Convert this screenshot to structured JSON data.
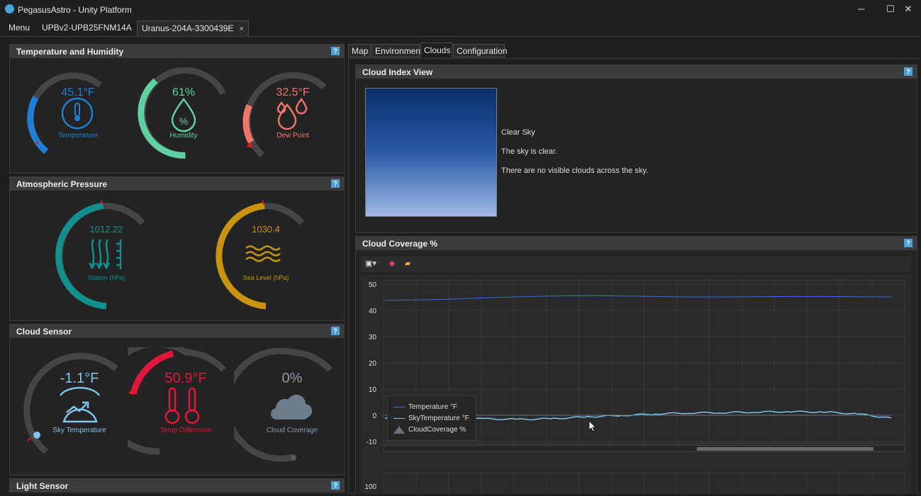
{
  "window": {
    "title": "PegasusAstro - Unity Platform",
    "minimize": "─",
    "maximize": "☐",
    "close": "✕"
  },
  "tabs": {
    "menu": "Menu",
    "device1": "UPBv2-UPB25FNM14A",
    "device2": "Uranus-204A-3300439E",
    "close": "×"
  },
  "help_label": "?",
  "panels": {
    "temp_humidity": {
      "title": "Temperature and Humidity",
      "temperature": {
        "value": "45.1°F",
        "label": "Temperature",
        "color": "#1f7fd6"
      },
      "humidity": {
        "value": "61%",
        "label": "Humidity",
        "color": "#5fd0a0"
      },
      "dew_point": {
        "value": "32.5°F",
        "label": "Dew Point",
        "color": "#f0746a"
      }
    },
    "pressure": {
      "title": "Atmospheric Pressure",
      "station": {
        "value": "1012.22",
        "label": "Station (hPa)",
        "color": "#12908f"
      },
      "sea_level": {
        "value": "1030.4",
        "label": "Sea Level (hPa)",
        "color": "#c9930d"
      }
    },
    "cloud_sensor": {
      "title": "Cloud Sensor",
      "sky_temperature": {
        "value": "-1.1°F",
        "label": "Sky Temperature",
        "color": "#7fc4ec"
      },
      "temp_difference": {
        "value": "50.9°F",
        "label": "Temp Difference",
        "color": "#e0173a"
      },
      "cloud_coverage": {
        "value": "0%",
        "label": "Cloud Coverage",
        "color": "#8a9aa8"
      }
    },
    "light_sensor": {
      "title": "Light Sensor"
    }
  },
  "right_tabs": [
    "Map",
    "Environment",
    "Clouds",
    "Configuration"
  ],
  "cloud_index": {
    "title": "Cloud Index View",
    "status": "Clear Sky",
    "line1": "The sky is clear.",
    "line2": "There are no visible clouds across the sky."
  },
  "cloud_coverage_chart": {
    "title": "Cloud Coverage %",
    "toolbar_icons": [
      "save-icon",
      "eraser-icon",
      "folder-open-icon"
    ],
    "legend": [
      "Temperature °F",
      "SkyTemperature °F",
      "CloudCoverage %"
    ],
    "second_chart_tick": "100"
  },
  "chart_data": {
    "type": "line",
    "yticks": [
      50,
      40,
      30,
      20,
      10,
      0,
      -10
    ],
    "ylim": [
      -10,
      50
    ],
    "grid": true,
    "legend_position": "bottom-left",
    "series": [
      {
        "name": "Temperature °F",
        "color": "#3a6fd8",
        "values": [
          43.8,
          44.0,
          44.3,
          44.8,
          45.2,
          45.5,
          45.6,
          45.5,
          45.3,
          45.1,
          45.1,
          45.2,
          45.3,
          45.3,
          45.2,
          45.1
        ]
      },
      {
        "name": "SkyTemperature °F",
        "color": "#7fc4ec",
        "values": [
          -1.2,
          -1.0,
          -1.2,
          -1.4,
          -1.6,
          -1.3,
          -0.6,
          -0.1,
          0.5,
          0.9,
          1.0,
          1.2,
          1.4,
          1.2,
          0.5,
          -1.1
        ]
      },
      {
        "name": "CloudCoverage %",
        "color": "#6a7280",
        "values": [
          0,
          0,
          0,
          0,
          0,
          0,
          0,
          0,
          0,
          0,
          0,
          0,
          0,
          0,
          0,
          0
        ]
      }
    ]
  }
}
